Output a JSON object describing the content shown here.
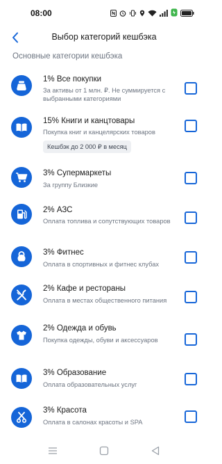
{
  "status_bar": {
    "time": "08:00",
    "icons": [
      "nfc-icon",
      "alarm-icon",
      "vibrate-icon",
      "location-icon",
      "wifi-icon",
      "signal-icon",
      "battery-saver-icon",
      "battery-icon"
    ]
  },
  "header": {
    "title": "Выбор категорий кешбэка"
  },
  "section": {
    "title": "Основные категории кешбэка"
  },
  "categories": [
    {
      "icon": "wallet-icon",
      "title": "1% Все покупки",
      "subtitle": "За активы от 1 млн. ₽. Не суммируется с выбранными категориями",
      "badge": "",
      "checked": false
    },
    {
      "icon": "book-icon",
      "title": "15% Книги и канцтовары",
      "subtitle": "Покупка книг и канцелярских товаров",
      "badge": "Кешбэк до 2 000 ₽ в месяц",
      "checked": false
    },
    {
      "icon": "cart-icon",
      "title": "3% Супермаркеты",
      "subtitle": "За группу Близкие",
      "badge": "",
      "checked": false
    },
    {
      "icon": "fuel-icon",
      "title": "2% АЗС",
      "subtitle": "Оплата топлива и сопутствующих товаров",
      "badge": "",
      "checked": false
    },
    {
      "icon": "kettlebell-icon",
      "title": "3% Фитнес",
      "subtitle": "Оплата в спортивных и фитнес клубах",
      "badge": "",
      "checked": false
    },
    {
      "icon": "fork-knife-icon",
      "title": "2% Кафе и рестораны",
      "subtitle": "Оплата в местах общественного питания",
      "badge": "",
      "checked": false
    },
    {
      "icon": "tshirt-icon",
      "title": "2% Одежда и обувь",
      "subtitle": "Покупка одежды, обуви и аксессуаров",
      "badge": "",
      "checked": false
    },
    {
      "icon": "book-icon",
      "title": "3% Образование",
      "subtitle": "Оплата образовательных услуг",
      "badge": "",
      "checked": false
    },
    {
      "icon": "scissors-icon",
      "title": "3% Красота",
      "subtitle": "Оплата в салонах красоты и SPA",
      "badge": "",
      "checked": false
    }
  ],
  "nav_bar": {
    "buttons": [
      "menu-icon",
      "home-icon",
      "back-triangle-icon"
    ]
  },
  "colors": {
    "accent": "#1565d8",
    "text_primary": "#1a1a1a",
    "text_secondary": "#6c7480",
    "badge_bg": "#eef0f3"
  }
}
